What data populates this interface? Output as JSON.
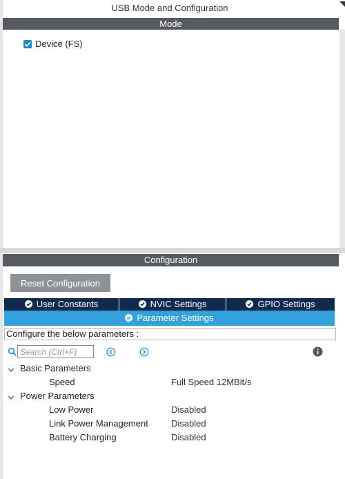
{
  "window": {
    "title": "USB Mode and Configuration"
  },
  "mode": {
    "header": "Mode",
    "device_checkbox": {
      "label": "Device (FS)",
      "checked": true
    }
  },
  "configuration": {
    "header": "Configuration",
    "reset_button": "Reset Configuration",
    "tabs": [
      {
        "label": "User Constants",
        "active": false
      },
      {
        "label": "NVIC Settings",
        "active": false
      },
      {
        "label": "GPIO Settings",
        "active": false
      },
      {
        "label": "Parameter Settings",
        "active": true
      }
    ],
    "instruction": "Configure the below parameters :",
    "search": {
      "placeholder": "Search (Ctrl+F)",
      "value": ""
    },
    "groups": [
      {
        "label": "Basic Parameters",
        "params": [
          {
            "name": "Speed",
            "value": "Full Speed 12MBit/s"
          }
        ]
      },
      {
        "label": "Power Parameters",
        "params": [
          {
            "name": "Low Power",
            "value": "Disabled"
          },
          {
            "name": "Link Power Management",
            "value": "Disabled"
          },
          {
            "name": "Battery Charging",
            "value": "Disabled"
          }
        ]
      }
    ]
  },
  "colors": {
    "section_header": "#575a5e",
    "tab_inactive": "#0f2a4d",
    "tab_active": "#33a2dc",
    "checkbox": "#1e88c9",
    "button": "#8f9396"
  },
  "icons": {
    "checkbox_check": "check-icon",
    "tab_check": "circle-check-icon",
    "search": "search-icon",
    "previous": "arrow-left-circle-icon",
    "next": "arrow-right-circle-icon",
    "info": "info-icon",
    "expand": "chevron-down-icon"
  }
}
